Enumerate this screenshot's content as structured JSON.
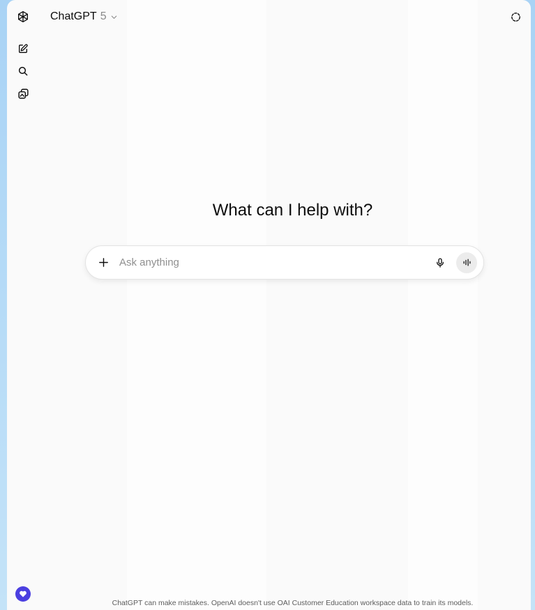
{
  "header": {
    "model_name": "ChatGPT",
    "model_version": "5"
  },
  "sidebar": {
    "icons": [
      "openai-logo-icon",
      "new-chat-icon",
      "search-icon",
      "library-icon"
    ]
  },
  "main": {
    "hero_title": "What can I help with?",
    "composer": {
      "placeholder": "Ask anything",
      "value": ""
    }
  },
  "footer": {
    "disclaimer": "ChatGPT can make mistakes. OpenAI doesn't use OAI Customer Education workspace data to train its models."
  },
  "colors": {
    "page_background": "#a9d3f5",
    "window_background": "#fafafa",
    "help_badge": "#4b3fe0"
  }
}
